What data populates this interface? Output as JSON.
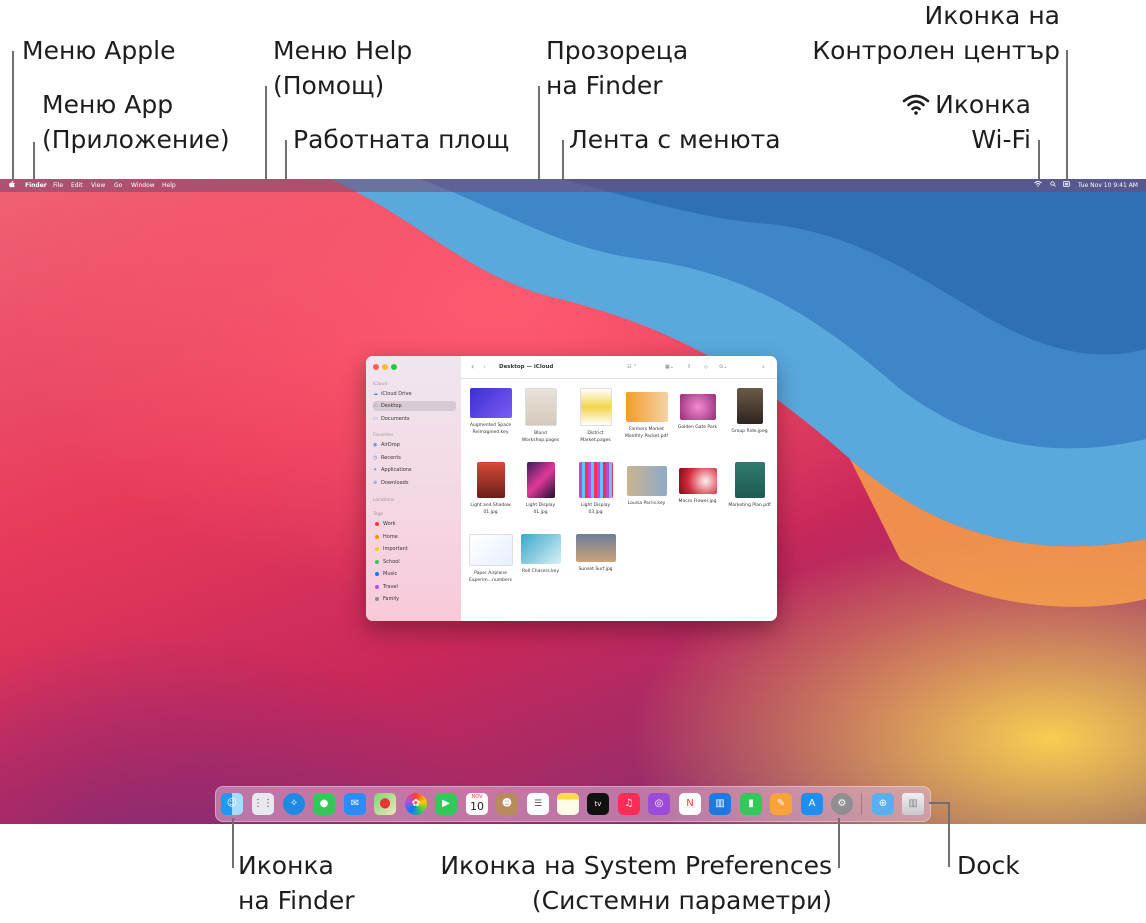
{
  "callouts": {
    "apple_menu": "Меню Apple",
    "app_menu_l1": "Меню App",
    "app_menu_l2": "(Приложение)",
    "help_menu_l1": "Меню Help",
    "help_menu_l2": "(Помощ)",
    "desktop": "Работната площ",
    "finder_window_l1": "Прозореца",
    "finder_window_l2": "на Finder",
    "menu_bar": "Лента с менюта",
    "control_center_l1": "Иконка на",
    "control_center_l2": "Контролен център",
    "wifi_l1": "Иконка",
    "wifi_l2": "Wi-Fi",
    "finder_icon_l1": "Иконка",
    "finder_icon_l2": "на Finder",
    "system_prefs_l1": "Иконка на System Preferences",
    "system_prefs_l2": "(Системни параметри)",
    "dock": "Dock"
  },
  "menubar": {
    "items": [
      "Finder",
      "File",
      "Edit",
      "View",
      "Go",
      "Window",
      "Help"
    ],
    "clock": "Tue Nov 10  9:41 AM"
  },
  "finder": {
    "title": "Desktop — iCloud",
    "sidebar": {
      "icloud_header": "iCloud",
      "icloud_items": [
        "iCloud Drive",
        "Desktop",
        "Documents"
      ],
      "favorites_header": "Favorites",
      "favorites_items": [
        "AirDrop",
        "Recents",
        "Applications",
        "Downloads"
      ],
      "locations_header": "Locations",
      "tags_header": "Tags",
      "tags": [
        "Work",
        "Home",
        "Important",
        "School",
        "Music",
        "Travel",
        "Family"
      ]
    },
    "files": [
      "Augmented Space\nReimagined.key",
      "Bland\nWorkshop.pages",
      "District\nMarket.pages",
      "Farmers Market\nMonthly Packet.pdf",
      "Golden Gate Park",
      "Group Ride.jpeg",
      "Light and Shadow\n01.jpg",
      "Light Display\n01.jpg",
      "Light Display\n03.jpg",
      "Louisa Parris.key",
      "Macro Flower.jpg",
      "Marketing Plan.pdf",
      "Paper Airplane\nExperim…numbers",
      "Roll Chasers.key",
      "Sunset Surf.jpg"
    ]
  },
  "dock": {
    "calendar_month": "NOV",
    "calendar_day": "10",
    "tv_label": "tv"
  },
  "colors": {
    "leader": "#6e6e73",
    "accent": "#4a90e2"
  }
}
